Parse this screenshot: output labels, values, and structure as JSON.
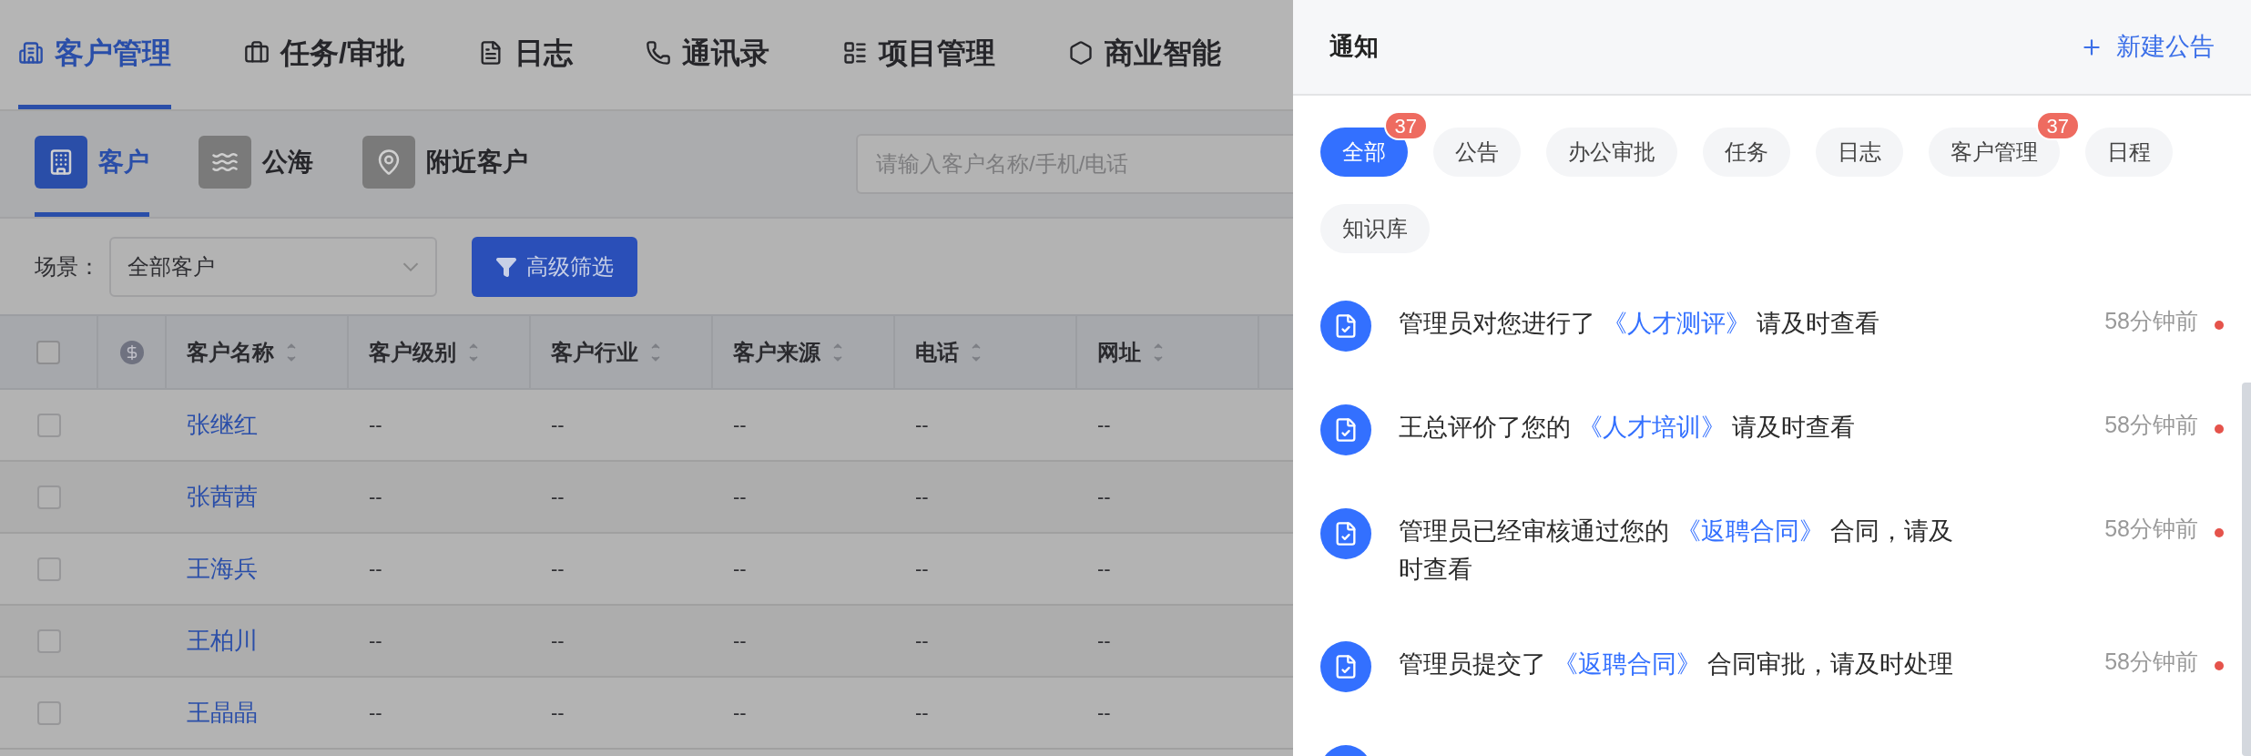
{
  "top_nav": [
    {
      "label": "客户管理",
      "selected": true
    },
    {
      "label": "任务/审批",
      "selected": false
    },
    {
      "label": "日志",
      "selected": false
    },
    {
      "label": "通讯录",
      "selected": false
    },
    {
      "label": "项目管理",
      "selected": false
    },
    {
      "label": "商业智能",
      "selected": false
    }
  ],
  "sub_tabs": [
    {
      "label": "客户",
      "selected": true
    },
    {
      "label": "公海",
      "selected": false
    },
    {
      "label": "附近客户",
      "selected": false
    }
  ],
  "search": {
    "placeholder": "请输入客户名称/手机/电话"
  },
  "filter": {
    "label": "场景：",
    "scene": "全部客户",
    "advanced_button": "高级筛选"
  },
  "table": {
    "select_all": {
      "checked": false
    },
    "columns": [
      "客户名称",
      "客户级别",
      "客户行业",
      "客户来源",
      "电话",
      "网址"
    ],
    "rows": [
      {
        "checked": false,
        "cells": [
          "张继红",
          "--",
          "--",
          "--",
          "--",
          "--"
        ]
      },
      {
        "checked": false,
        "cells": [
          "张茜茜",
          "--",
          "--",
          "--",
          "--",
          "--"
        ]
      },
      {
        "checked": false,
        "cells": [
          "王海兵",
          "--",
          "--",
          "--",
          "--",
          "--"
        ]
      },
      {
        "checked": false,
        "cells": [
          "王柏川",
          "--",
          "--",
          "--",
          "--",
          "--"
        ]
      },
      {
        "checked": false,
        "cells": [
          "王晶晶",
          "--",
          "--",
          "--",
          "--",
          "--"
        ]
      }
    ]
  },
  "drawer": {
    "title": "通知",
    "new_button": "新建公告",
    "chips": [
      {
        "label": "全部",
        "selected": true,
        "badge": "37"
      },
      {
        "label": "公告",
        "selected": false
      },
      {
        "label": "办公审批",
        "selected": false
      },
      {
        "label": "任务",
        "selected": false
      },
      {
        "label": "日志",
        "selected": false
      },
      {
        "label": "客户管理",
        "selected": false,
        "badge": "37"
      },
      {
        "label": "日程",
        "selected": false
      },
      {
        "label": "知识库",
        "selected": false
      }
    ],
    "notifications": [
      {
        "before": "管理员对您进行了",
        "link": "《人才测评》",
        "after": "请及时查看",
        "time": "58分钟前",
        "unread": true
      },
      {
        "before": "王总评价了您的",
        "link": "《人才培训》",
        "after": "请及时查看",
        "time": "58分钟前",
        "unread": true
      },
      {
        "before": "管理员已经审核通过您的",
        "link": "《返聘合同》",
        "after": "合同，请及时查看",
        "time": "58分钟前",
        "unread": true
      },
      {
        "before": "管理员提交了",
        "link": "《返聘合同》",
        "after": "合同审批，请及时处理",
        "time": "58分钟前",
        "unread": true
      }
    ]
  }
}
